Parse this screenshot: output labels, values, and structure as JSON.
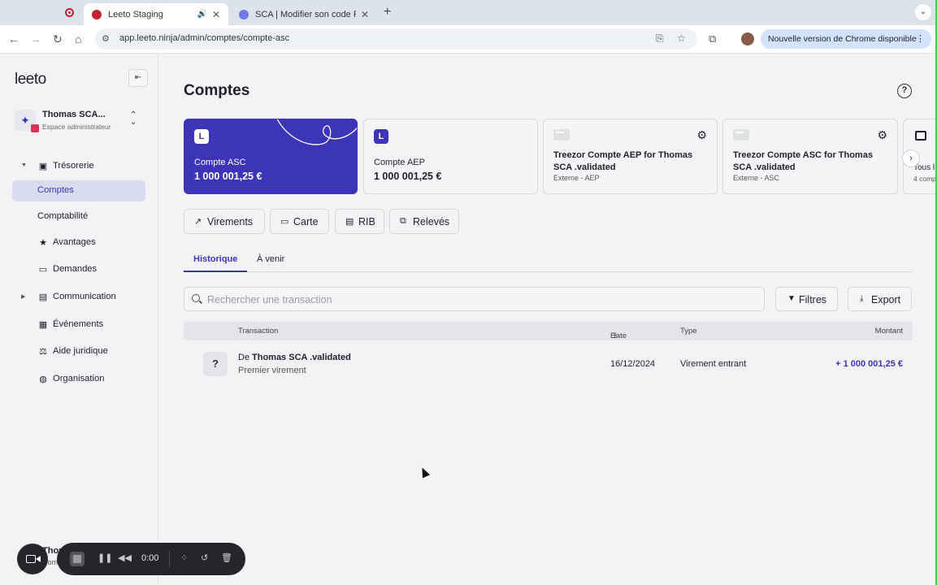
{
  "browser": {
    "tabs": [
      {
        "title": "Leeto Staging",
        "active": true
      },
      {
        "title": "SCA | Modifier son code PIN d",
        "active": false
      }
    ],
    "url": "app.leeto.ninja/admin/comptes/compte-asc",
    "update_notice": "Nouvelle version de Chrome disponible"
  },
  "sidebar": {
    "logo": "leeto",
    "user": {
      "name": "Thomas SCA...",
      "role": "Espace administrateur"
    },
    "nav": {
      "tresorerie": "Trésorerie",
      "comptes": "Comptes",
      "comptabilite": "Comptabilité",
      "avantages": "Avantages",
      "demandes": "Demandes",
      "communication": "Communication",
      "evenements": "Événements",
      "aide_juridique": "Aide juridique",
      "organisation": "Organisation"
    },
    "footer_peek": {
      "name": "Thom",
      "sub": "Com"
    }
  },
  "main": {
    "title": "Comptes",
    "accounts": [
      {
        "name": "Compte ASC",
        "amount": "1 000 001,25 €",
        "selected": true
      },
      {
        "name": "Compte AEP",
        "amount": "1 000 001,25 €",
        "selected": false
      },
      {
        "name": "Treezor Compte AEP for Thomas SCA .validated",
        "sub": "Externe - AEP"
      },
      {
        "name": "Treezor Compte ASC for Thomas SCA .validated",
        "sub": "Externe - ASC"
      },
      {
        "name": "Tous l",
        "sub": "4 comp"
      }
    ],
    "actions": {
      "virements": "Virements",
      "carte": "Carte",
      "rib": "RIB",
      "releves": "Relevés"
    },
    "tabs": {
      "historique": "Historique",
      "a_venir": "À venir"
    },
    "search_placeholder": "Rechercher une transaction",
    "filters_label": "Filtres",
    "export_label": "Export",
    "table": {
      "headers": {
        "transaction": "Transaction",
        "date": "Date",
        "type": "Type",
        "montant": "Montant"
      },
      "rows": [
        {
          "icon": "?",
          "prefix": "De",
          "party": "Thomas SCA .validated",
          "subtitle": "Premier virement",
          "date": "16/12/2024",
          "type": "Virement entrant",
          "amount": "+ 1 000 001,25 €"
        }
      ]
    }
  },
  "recorder": {
    "time": "0:00"
  },
  "colors": {
    "accent": "#3d35b8",
    "background": "#f3f3f5",
    "brand_red": "#d63458"
  }
}
